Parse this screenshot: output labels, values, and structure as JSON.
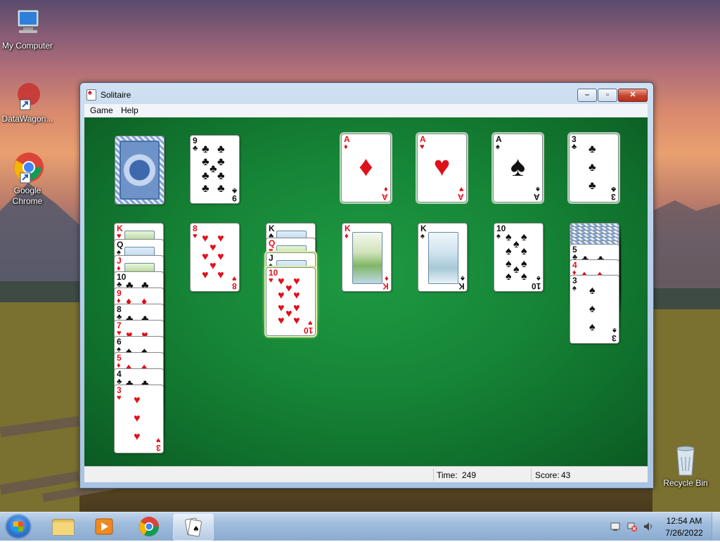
{
  "desktop": {
    "icons": [
      {
        "label": "My Computer"
      },
      {
        "label": "DataWagon..."
      },
      {
        "label": "Google Chrome"
      },
      {
        "label": "Recycle Bin"
      }
    ]
  },
  "window": {
    "title": "Solitaire",
    "menu": [
      "Game",
      "Help"
    ],
    "status": {
      "time_label": "Time:",
      "time_value": "249",
      "score_label": "Score:",
      "score_value": "43"
    }
  },
  "game": {
    "stock": {
      "face_down": true
    },
    "waste": {
      "rank": "9",
      "suit": "clubs"
    },
    "foundations": [
      {
        "rank": "A",
        "suit": "diamonds"
      },
      {
        "rank": "A",
        "suit": "hearts"
      },
      {
        "rank": "A",
        "suit": "spades"
      },
      {
        "rank": "3",
        "suit": "clubs"
      }
    ],
    "tableau": [
      {
        "face_down": 0,
        "cards": [
          {
            "rank": "K",
            "suit": "hearts"
          },
          {
            "rank": "Q",
            "suit": "spades"
          },
          {
            "rank": "J",
            "suit": "diamonds"
          },
          {
            "rank": "10",
            "suit": "clubs"
          },
          {
            "rank": "9",
            "suit": "diamonds"
          },
          {
            "rank": "8",
            "suit": "clubs"
          },
          {
            "rank": "7",
            "suit": "hearts"
          },
          {
            "rank": "6",
            "suit": "spades"
          },
          {
            "rank": "5",
            "suit": "diamonds"
          },
          {
            "rank": "4",
            "suit": "clubs"
          },
          {
            "rank": "3",
            "suit": "hearts"
          }
        ]
      },
      {
        "face_down": 0,
        "cards": [
          {
            "rank": "8",
            "suit": "hearts"
          }
        ]
      },
      {
        "face_down": 0,
        "cards": [
          {
            "rank": "K",
            "suit": "clubs"
          },
          {
            "rank": "Q",
            "suit": "hearts"
          },
          {
            "rank": "J",
            "suit": "spades"
          },
          {
            "rank": "10",
            "suit": "hearts"
          }
        ]
      },
      {
        "face_down": 0,
        "cards": [
          {
            "rank": "K",
            "suit": "diamonds"
          }
        ]
      },
      {
        "face_down": 0,
        "cards": [
          {
            "rank": "K",
            "suit": "spades"
          }
        ]
      },
      {
        "face_down": 0,
        "cards": [
          {
            "rank": "10",
            "suit": "spades"
          }
        ]
      },
      {
        "face_down": 6,
        "cards": [
          {
            "rank": "5",
            "suit": "clubs"
          },
          {
            "rank": "4",
            "suit": "diamonds"
          },
          {
            "rank": "3",
            "suit": "spades"
          }
        ]
      }
    ]
  },
  "taskbar": {
    "items": [
      "windows-explorer",
      "media-player",
      "chrome",
      "solitaire"
    ],
    "active": "solitaire",
    "clock_time": "12:54 AM",
    "clock_date": "7/26/2022"
  },
  "suits": {
    "hearts": "♥",
    "diamonds": "♦",
    "clubs": "♣",
    "spades": "♠"
  }
}
